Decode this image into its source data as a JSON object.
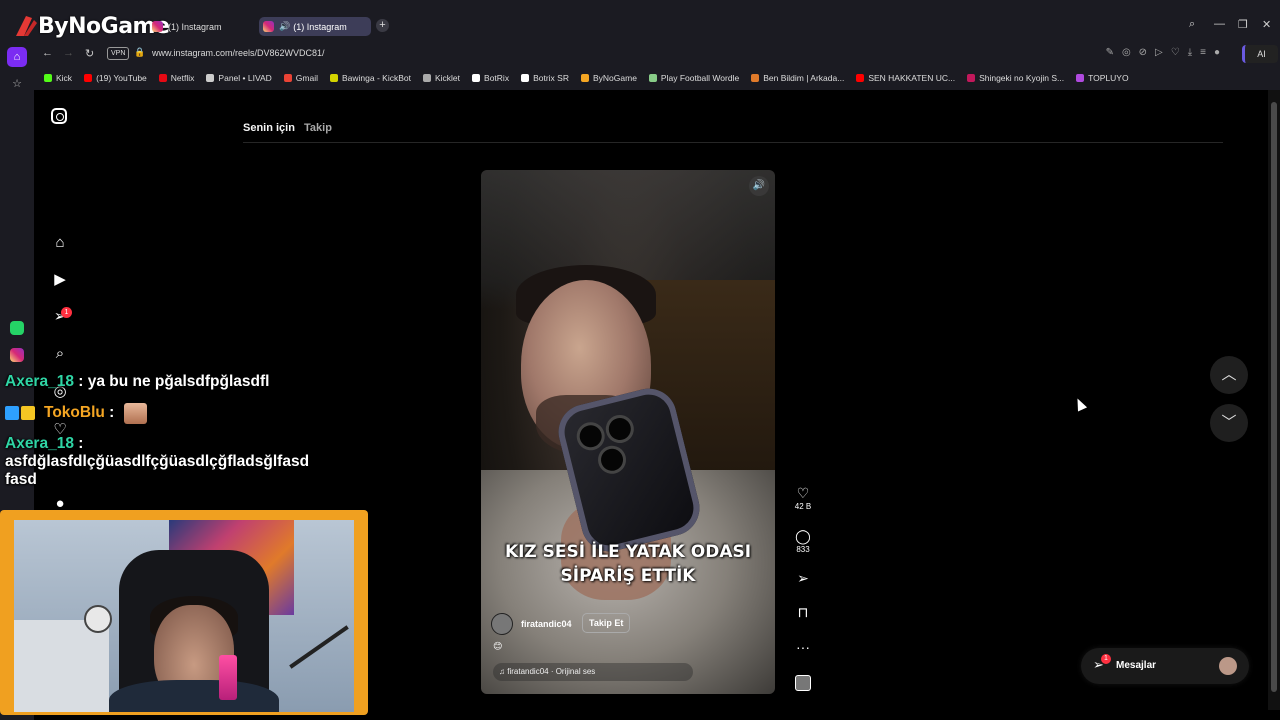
{
  "browser": {
    "brand": "ByNoGame",
    "tabs": [
      {
        "label": "(1) Instagram"
      },
      {
        "label": "(1) Instagram"
      }
    ],
    "url": "www.instagram.com/reels/DV862WVDC81/",
    "vpn_label": "VPN",
    "ai_label": "AI",
    "bookmarks": [
      {
        "label": "Kick",
        "color": "#53fc18"
      },
      {
        "label": "(19) YouTube",
        "color": "#ff0000"
      },
      {
        "label": "Netflix",
        "color": "#e50914"
      },
      {
        "label": "Panel • LIVAD",
        "color": "#cccccc"
      },
      {
        "label": "Gmail",
        "color": "#ea4335"
      },
      {
        "label": "Bawinga - KickBot",
        "color": "#d4d400"
      },
      {
        "label": "Kicklet",
        "color": "#aaaaaa"
      },
      {
        "label": "BotRix",
        "color": "#ffffff"
      },
      {
        "label": "Botrix SR",
        "color": "#ffffff"
      },
      {
        "label": "ByNoGame",
        "color": "#f5a623"
      },
      {
        "label": "Play Football Wordle",
        "color": "#88cc88"
      },
      {
        "label": "Ben Bildim | Arkada...",
        "color": "#e07a2a"
      },
      {
        "label": "SEN HAKKATEN UC...",
        "color": "#ff0000"
      },
      {
        "label": "Shingeki no Kyojin S...",
        "color": "#c2185b"
      },
      {
        "label": "TOPLUYO",
        "color": "#b04adf"
      }
    ]
  },
  "instagram": {
    "feed_tabs": {
      "for_you": "Senin için",
      "following": "Takip"
    },
    "notification_count": "1",
    "reel": {
      "caption_line1": "KIZ SESİ İLE YATAK ODASI",
      "caption_line2": "SİPARİŞ ETTİK",
      "username": "firatandic04",
      "follow_label": "Takip Et",
      "emoji": "😊",
      "audio": "firatandic04 · Orijinal ses"
    },
    "actions": {
      "likes": "42 B",
      "comments": "833"
    },
    "messages": {
      "label": "Mesajlar",
      "badge": "1"
    }
  },
  "stream_chat": [
    {
      "user": "Axera_18",
      "text": " : ya bu ne pğalsdfpğlasdfl"
    },
    {
      "user": "TokoBlu",
      "text": " : "
    },
    {
      "user": "Axera_18",
      "text": " :",
      "text2": "asfdğlasfdlçğüasdlfçğüasdlçğfladsğlfasd",
      "text3": "fasd"
    }
  ],
  "colors": {
    "accent_purple": "#7b2cf2",
    "notification_red": "#ff3040",
    "chat_name_green": "#2fd5a5",
    "chat_name_orange": "#f5a623",
    "webcam_border": "#f0a020"
  }
}
